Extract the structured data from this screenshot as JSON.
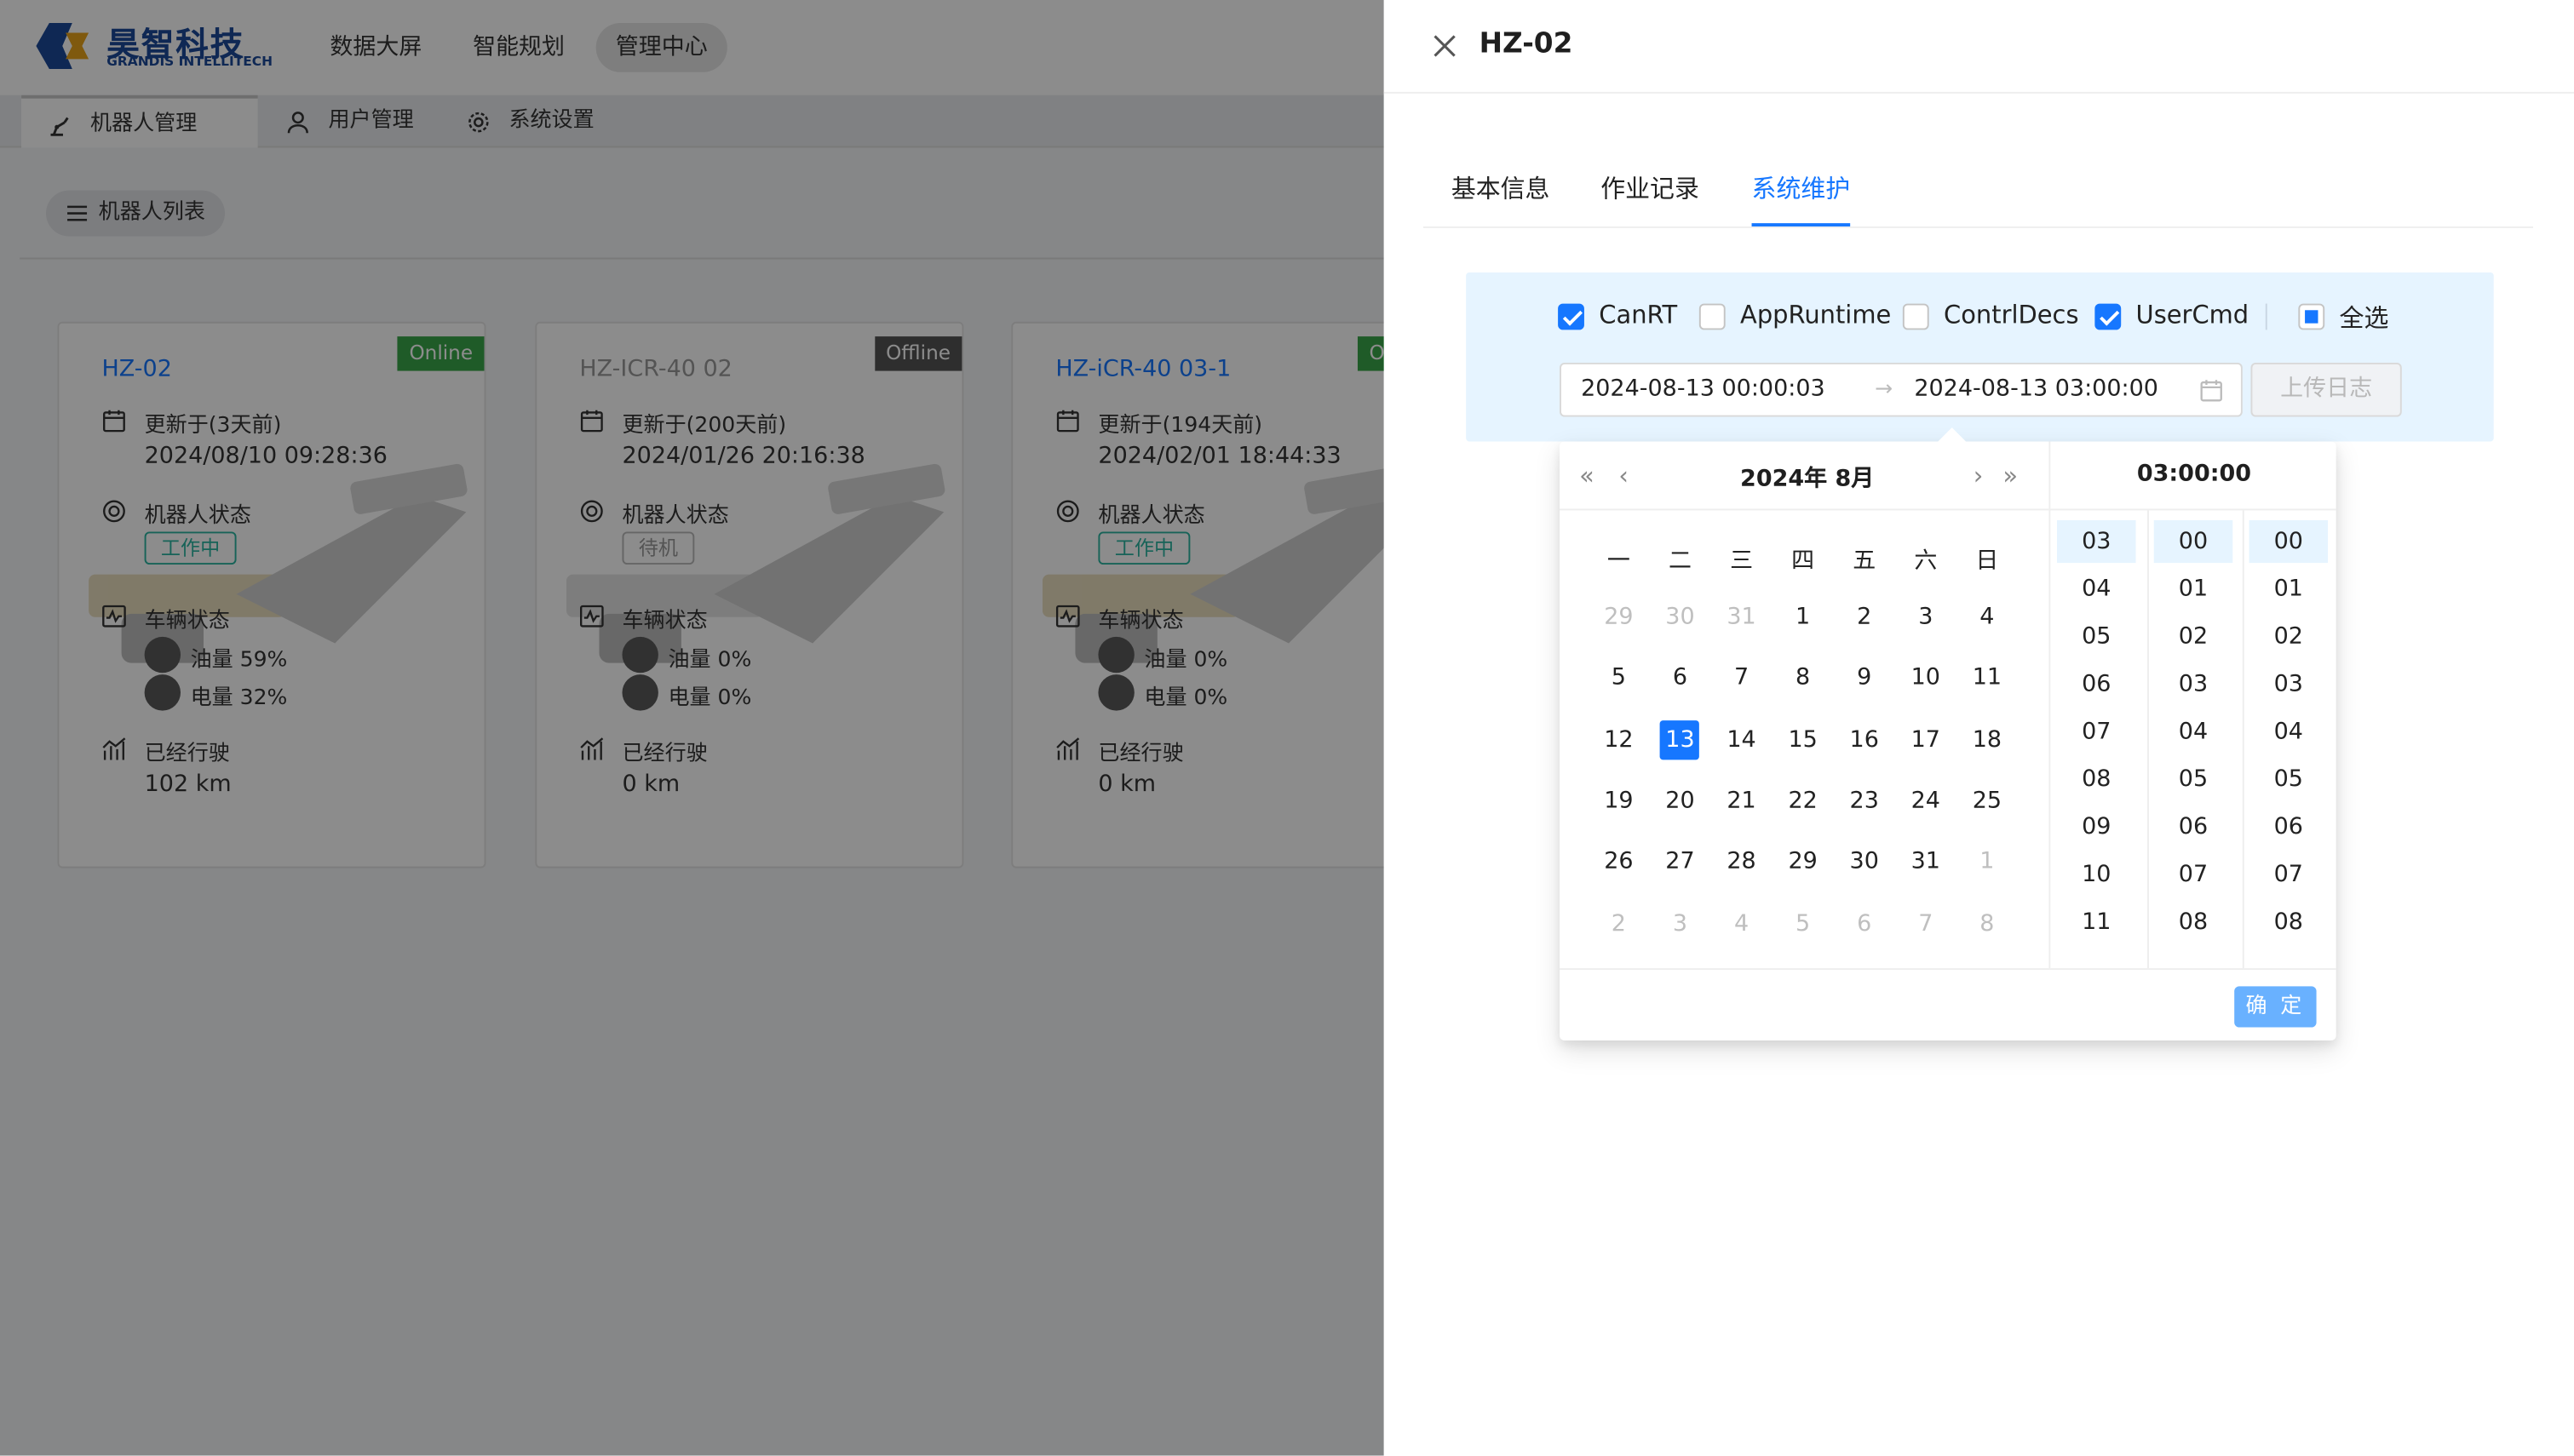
{
  "header": {
    "logo_cn": "昊智科技",
    "logo_en": "GRANDIS INTELLITECH",
    "nav": [
      "数据大屏",
      "智能规划",
      "管理中心"
    ]
  },
  "subtabs": [
    "机器人管理",
    "用户管理",
    "系统设置"
  ],
  "list_button": "机器人列表",
  "cards": [
    {
      "name": "HZ-02",
      "status_badge": "Online",
      "updated": "更新于(3天前)",
      "timestamp": "2024/08/10 09:28:36",
      "robot_state_label": "机器人状态",
      "robot_state": "工作中",
      "vehicle_label": "车辆状态",
      "fuel": "油量 59%",
      "battery": "电量 32%",
      "mileage_label": "已经行驶",
      "mileage": "102 km"
    },
    {
      "name": "HZ-ICR-40 02",
      "status_badge": "Offline",
      "updated": "更新于(200天前)",
      "timestamp": "2024/01/26 20:16:38",
      "robot_state_label": "机器人状态",
      "robot_state": "待机",
      "vehicle_label": "车辆状态",
      "fuel": "油量 0%",
      "battery": "电量 0%",
      "mileage_label": "已经行驶",
      "mileage": "0 km"
    },
    {
      "name": "HZ-iCR-40 03-1",
      "status_badge": "O",
      "updated": "更新于(194天前)",
      "timestamp": "2024/02/01 18:44:33",
      "robot_state_label": "机器人状态",
      "robot_state": "工作中",
      "vehicle_label": "车辆状态",
      "fuel": "油量 0%",
      "battery": "电量 0%",
      "mileage_label": "已经行驶",
      "mileage": "0 km"
    }
  ],
  "drawer": {
    "title": "HZ-02",
    "tabs": [
      "基本信息",
      "作业记录",
      "系统维护"
    ],
    "active_tab": "系统维护",
    "log_types": [
      {
        "label": "CanRT",
        "checked": true
      },
      {
        "label": "AppRuntime",
        "checked": false
      },
      {
        "label": "ContrlDecs",
        "checked": false
      },
      {
        "label": "UserCmd",
        "checked": true
      }
    ],
    "select_all": {
      "label": "全选",
      "state": "indeterminate"
    },
    "range_start": "2024-08-13 00:00:03",
    "range_end": "2024-08-13 03:00:00",
    "range_separator": "→",
    "upload_button": "上传日志"
  },
  "picker": {
    "nav_prev_year": "«",
    "nav_prev_month": "‹",
    "nav_next_month": "›",
    "nav_next_year": "»",
    "month_title": "2024年  8月",
    "time_title": "03:00:00",
    "weekdays": [
      "一",
      "二",
      "三",
      "四",
      "五",
      "六",
      "日"
    ],
    "days": [
      [
        "29",
        "30",
        "31",
        "1",
        "2",
        "3",
        "4"
      ],
      [
        "5",
        "6",
        "7",
        "8",
        "9",
        "10",
        "11"
      ],
      [
        "12",
        "13",
        "14",
        "15",
        "16",
        "17",
        "18"
      ],
      [
        "19",
        "20",
        "21",
        "22",
        "23",
        "24",
        "25"
      ],
      [
        "26",
        "27",
        "28",
        "29",
        "30",
        "31",
        "1"
      ],
      [
        "2",
        "3",
        "4",
        "5",
        "6",
        "7",
        "8"
      ]
    ],
    "selected_day": "13",
    "hours": [
      "03",
      "04",
      "05",
      "06",
      "07",
      "08",
      "09",
      "10",
      "11"
    ],
    "minutes": [
      "00",
      "01",
      "02",
      "03",
      "04",
      "05",
      "06",
      "07",
      "08"
    ],
    "seconds": [
      "00",
      "01",
      "02",
      "03",
      "04",
      "05",
      "06",
      "07",
      "08"
    ],
    "ok_button": "确 定"
  },
  "colors": {
    "accent": "#1677ff",
    "online": "#3aa74a",
    "offline": "#555555",
    "brand": "#1c4a9a",
    "working_tag": "#2bb5a0",
    "idle_tag": "#999999"
  }
}
